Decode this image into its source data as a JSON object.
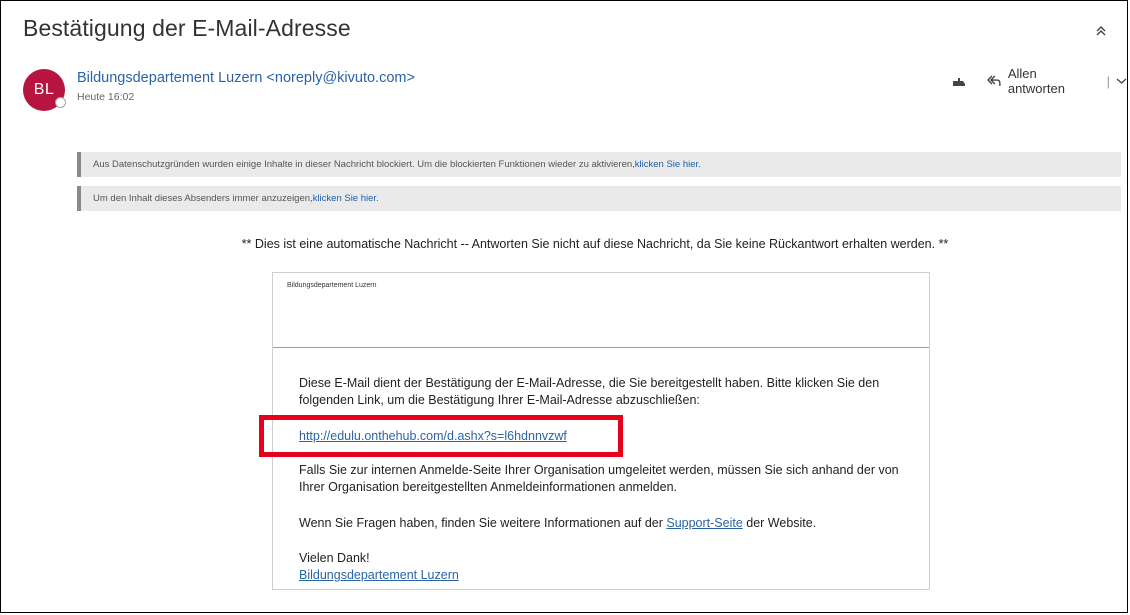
{
  "email": {
    "subject": "Bestätigung der E-Mail-Adresse",
    "sender": {
      "initials": "BL",
      "display": "Bildungsdepartement Luzern <noreply@kivuto.com>",
      "avatar_color": "#b7153f"
    },
    "date": "Heute 16:02"
  },
  "toolbar": {
    "reply_all_label": "Allen antworten",
    "separator": "|"
  },
  "notices": [
    {
      "text": "Aus Datenschutzgründen wurden einige Inhalte in dieser Nachricht blockiert. Um die blockierten Funktionen wieder zu aktivieren, ",
      "link": "klicken Sie hier."
    },
    {
      "text": "Um den Inhalt dieses Absenders immer anzuzeigen, ",
      "link": "klicken Sie hier."
    }
  ],
  "body": {
    "auto_message": "** Dies ist eine automatische Nachricht -- Antworten Sie nicht auf diese Nachricht, da Sie keine Rückantwort erhalten werden. **",
    "org_header": "Bildungsdepartement Luzern",
    "paragraph_1": "Diese E-Mail dient der Bestätigung der E-Mail-Adresse, die Sie bereitgestellt haben. Bitte klicken Sie den folgenden Link, um die Bestätigung Ihrer E-Mail-Adresse abzuschließen:",
    "confirm_link": "http://edulu.onthehub.com/d.ashx?s=l6hdnnvzwf",
    "paragraph_2": "Falls Sie zur internen Anmelde-Seite Ihrer Organisation umgeleitet werden, müssen Sie sich anhand der von Ihrer Organisation bereitgestellten Anmeldeinformationen anmelden.",
    "paragraph_3_before": "Wenn Sie Fragen haben, finden Sie weitere Informationen auf der ",
    "paragraph_3_link": "Support-Seite",
    "paragraph_3_after": " der Website.",
    "thanks": "Vielen Dank!",
    "signature_link": "Bildungsdepartement Luzern"
  },
  "colors": {
    "link": "#2a64a8",
    "highlight": "#e8001c",
    "notice_bg": "#eaeaea"
  }
}
